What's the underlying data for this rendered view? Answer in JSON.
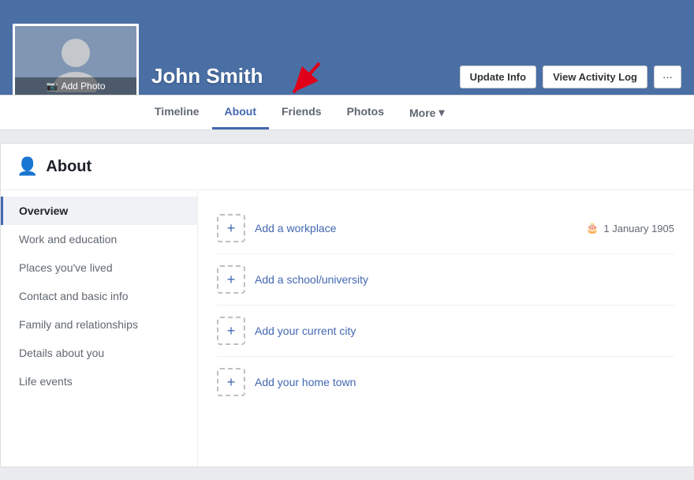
{
  "profile": {
    "name": "John Smith",
    "add_photo_label": "Add Photo"
  },
  "header_buttons": {
    "update_info": "Update Info",
    "view_activity_log": "View Activity Log",
    "more_dots": "···"
  },
  "nav": {
    "tabs": [
      {
        "id": "timeline",
        "label": "Timeline",
        "active": false
      },
      {
        "id": "about",
        "label": "About",
        "active": true
      },
      {
        "id": "friends",
        "label": "Friends",
        "active": false
      },
      {
        "id": "photos",
        "label": "Photos",
        "active": false
      }
    ],
    "more_label": "More",
    "more_chevron": "▾"
  },
  "about_section": {
    "title": "About",
    "sidebar": [
      {
        "id": "overview",
        "label": "Overview",
        "active": true
      },
      {
        "id": "work-education",
        "label": "Work and education",
        "active": false
      },
      {
        "id": "places",
        "label": "Places you've lived",
        "active": false
      },
      {
        "id": "contact",
        "label": "Contact and basic info",
        "active": false
      },
      {
        "id": "family",
        "label": "Family and relationships",
        "active": false
      },
      {
        "id": "details",
        "label": "Details about you",
        "active": false
      },
      {
        "id": "life-events",
        "label": "Life events",
        "active": false
      }
    ],
    "content_items": [
      {
        "id": "workplace",
        "label": "Add a workplace"
      },
      {
        "id": "school",
        "label": "Add a school/university"
      },
      {
        "id": "city",
        "label": "Add your current city"
      },
      {
        "id": "hometown",
        "label": "Add your home town"
      }
    ],
    "birthday": "1 January 1905"
  }
}
